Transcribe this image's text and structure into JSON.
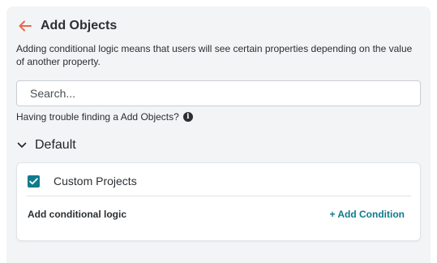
{
  "panel": {
    "title": "Add Objects",
    "description": "Adding conditional logic means that users will see certain properties depending on the value of another property.",
    "back_icon": "arrow-left-icon"
  },
  "search": {
    "placeholder": "Search...",
    "value": ""
  },
  "help": {
    "text": "Having trouble finding a Add Objects?",
    "icon": "info-icon"
  },
  "section": {
    "title": "Default",
    "expanded": true,
    "icon": "chevron-down-icon"
  },
  "card": {
    "item_label": "Custom Projects",
    "checked": true,
    "logic_label": "Add conditional logic",
    "add_condition_label": "+ Add Condition"
  },
  "colors": {
    "accent": "#0f7b8c",
    "back_arrow": "#e8694f",
    "panel_bg": "#f3f4f6"
  }
}
